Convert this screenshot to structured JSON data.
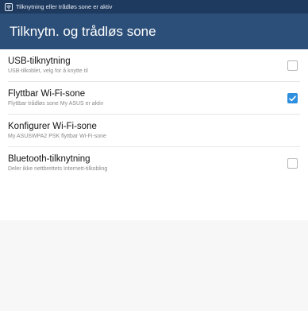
{
  "status_bar": {
    "icon": "wifi-hotspot-icon",
    "text": "Tilknytning eller trådløs sone er aktiv"
  },
  "action_bar": {
    "title": "Tilknytn. og trådløs sone"
  },
  "items": [
    {
      "title": "USB-tilknytning",
      "summary": "USB-tilkoblet, velg for å knytte til",
      "has_checkbox": true,
      "checked": false
    },
    {
      "title": "Flyttbar Wi-Fi-sone",
      "summary": "Flyttbar trådløs sone My ASUS er aktiv",
      "has_checkbox": true,
      "checked": true
    },
    {
      "title": "Konfigurer Wi-Fi-sone",
      "summary": "My ASUSWPA2 PSK flyttbar Wi-Fi-sone",
      "has_checkbox": false,
      "checked": false
    },
    {
      "title": "Bluetooth-tilknytning",
      "summary": "Deler ikke nettbrettets Internett-tilkobling",
      "has_checkbox": true,
      "checked": false
    }
  ],
  "colors": {
    "status_bar": "#1f3a5f",
    "action_bar": "#2c4f79",
    "checkbox_checked": "#2f8fdf"
  }
}
